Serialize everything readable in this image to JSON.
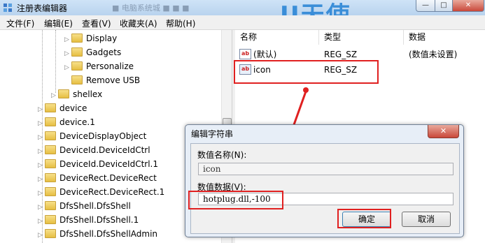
{
  "window": {
    "title": "注册表编辑器",
    "blurred_title_text": "■ 电脑系统城 ■ ■ ■",
    "brand_watermark": "U天使",
    "minimize_glyph": "—",
    "maximize_glyph": "□",
    "close_glyph": "✕"
  },
  "menu": {
    "items": [
      {
        "label": "文件(F)"
      },
      {
        "label": "编辑(E)"
      },
      {
        "label": "查看(V)"
      },
      {
        "label": "收藏夹(A)"
      },
      {
        "label": "帮助(H)"
      }
    ]
  },
  "tree": {
    "items": [
      {
        "label": "Display"
      },
      {
        "label": "Gadgets"
      },
      {
        "label": "Personalize"
      },
      {
        "label": "Remove USB"
      },
      {
        "label": "shellex"
      },
      {
        "label": "device"
      },
      {
        "label": "device.1"
      },
      {
        "label": "DeviceDisplayObject"
      },
      {
        "label": "DeviceId.DeviceIdCtrl"
      },
      {
        "label": "DeviceId.DeviceIdCtrl.1"
      },
      {
        "label": "DeviceRect.DeviceRect"
      },
      {
        "label": "DeviceRect.DeviceRect.1"
      },
      {
        "label": "DfsShell.DfsShell"
      },
      {
        "label": "DfsShell.DfsShell.1"
      },
      {
        "label": "DfsShell.DfsShellAdmin"
      }
    ]
  },
  "values_list": {
    "headers": {
      "name": "名称",
      "type": "类型",
      "data": "数据"
    },
    "rows": [
      {
        "icon": "ab",
        "name": "(默认)",
        "type": "REG_SZ",
        "data": "(数值未设置)"
      },
      {
        "icon": "ab",
        "name": "icon",
        "type": "REG_SZ",
        "data": ""
      }
    ]
  },
  "dialog": {
    "title": "编辑字符串",
    "close_glyph": "✕",
    "value_name_label": "数值名称(N):",
    "value_name": "icon",
    "value_data_label": "数值数据(V):",
    "value_data": "hotplug.dll,-100",
    "ok_label": "确定",
    "cancel_label": "取消"
  },
  "colors": {
    "highlight": "#e02020",
    "titlebar": "#b9d3ee",
    "folder": "#e6be42"
  }
}
